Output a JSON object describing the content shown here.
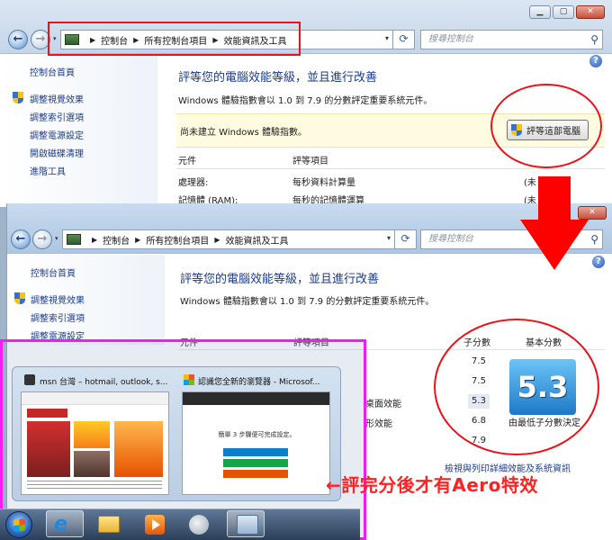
{
  "address": {
    "breadcrumbs": [
      "控制台",
      "所有控制台項目",
      "效能資訊及工具"
    ],
    "search_placeholder": "搜尋控制台"
  },
  "sidebar": {
    "home": "控制台首頁",
    "items": [
      "調整視覺效果",
      "調整索引選項",
      "調整電源設定",
      "開啟磁碟清理",
      "進階工具"
    ]
  },
  "main": {
    "title": "評等您的電腦效能等級，並且進行改善",
    "description": "Windows 體驗指數會以 1.0 到 7.9 的分數評定重要系統元件。",
    "banner_text": "尚未建立 Windows 體驗指數。",
    "rate_button": "評等這部電腦",
    "table_headers": {
      "component": "元件",
      "rated": "評等項目",
      "subscore": "子分數",
      "base": "基本分數"
    },
    "rows_top": [
      {
        "component": "處理器:",
        "rated": "每秒資料計算量",
        "tail": "(未"
      },
      {
        "component": "記憶體 (RAM):",
        "rated": "每秒的記憶體運算",
        "tail": "(未"
      }
    ],
    "rows_bottom_partial": [
      "桌面效能",
      "形效能"
    ],
    "subscores": [
      "7.5",
      "7.5",
      "5.3",
      "6.8",
      "7.9"
    ],
    "base_score": "5.3",
    "base_caption": "由最低子分數決定",
    "footer_partial": "檢視與列印詳細效能及系統資訊"
  },
  "taskbar": {
    "thumb1_title": "msn 台灣 – hotmail, outlook, s...",
    "thumb2_title": "認識您全新的瀏覽器 - Microsof...",
    "thumb2_body": "簡單 3 步驟便可完成設定。"
  },
  "annotation": {
    "note": "←評完分後才有Aero特效"
  },
  "window_controls": {
    "minimize": "▁",
    "maximize": "▢",
    "close": "✕"
  },
  "icons": {
    "back": "←",
    "forward": "→",
    "refresh": "⟳",
    "search": "⚲",
    "help": "?",
    "dropdown": "▾"
  }
}
